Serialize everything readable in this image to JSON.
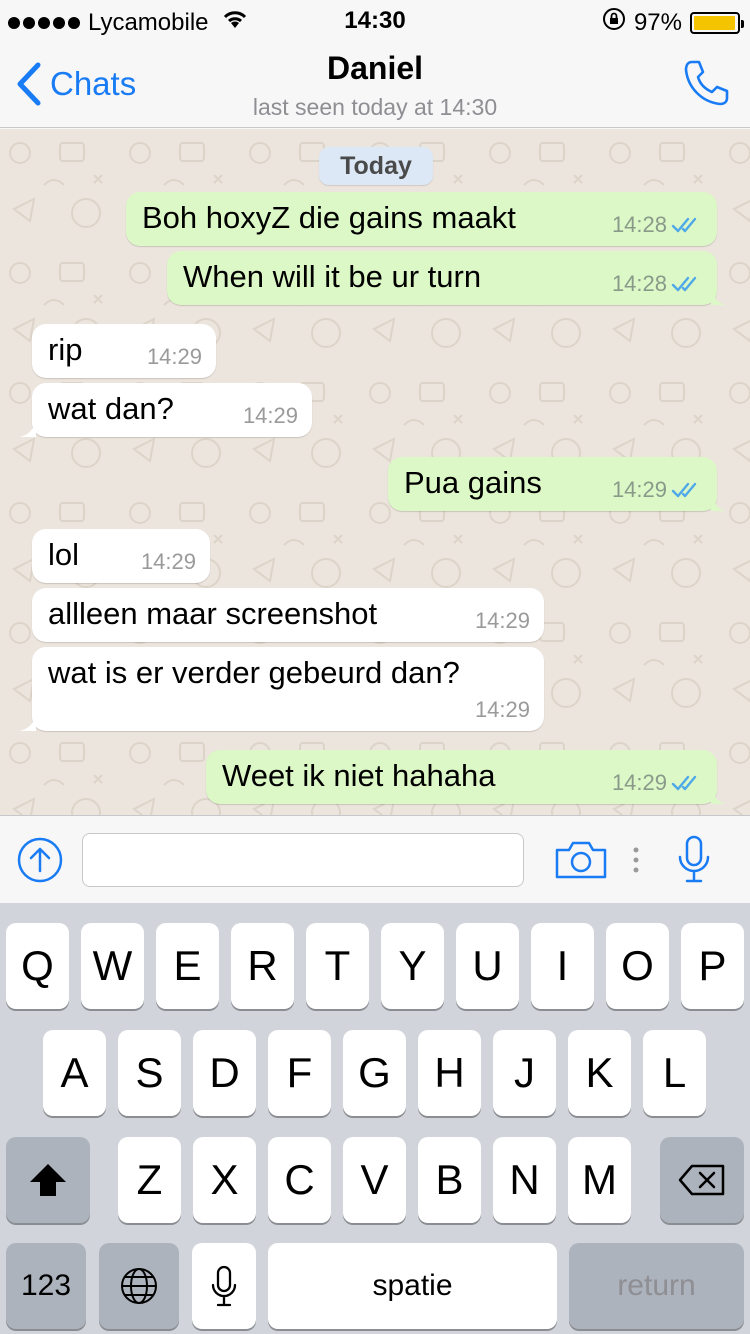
{
  "status_bar": {
    "carrier": "Lycamobile",
    "time": "14:30",
    "battery_percent": "97%",
    "battery_level": 0.97,
    "signal_dots": 5,
    "icons": [
      "wifi-icon",
      "rotation-lock-icon",
      "battery-icon"
    ]
  },
  "nav": {
    "back_label": "Chats",
    "title": "Daniel",
    "subtitle": "last seen today at 14:30",
    "icons": [
      "chevron-left-icon",
      "phone-icon"
    ]
  },
  "chat": {
    "day_label": "Today",
    "messages": [
      {
        "dir": "out",
        "text": "Boh hoxyZ die gains maakt",
        "time": "14:28",
        "status": "read"
      },
      {
        "dir": "out",
        "text": "When will it be ur turn",
        "time": "14:28",
        "status": "read"
      },
      {
        "dir": "in",
        "text": "rip",
        "time": "14:29"
      },
      {
        "dir": "in",
        "text": "wat dan?",
        "time": "14:29"
      },
      {
        "dir": "out",
        "text": "Pua gains",
        "time": "14:29",
        "status": "read"
      },
      {
        "dir": "in",
        "text": "lol",
        "time": "14:29"
      },
      {
        "dir": "in",
        "text": "allleen maar screenshot",
        "time": "14:29"
      },
      {
        "dir": "in",
        "text": "wat is er verder gebeurd dan?",
        "time": "14:29"
      },
      {
        "dir": "out",
        "text": "Weet ik niet hahaha",
        "time": "14:29",
        "status": "read"
      }
    ],
    "colors": {
      "outgoing": "#dcf8c6",
      "incoming": "#ffffff",
      "background": "#ece5dd",
      "read_ticks": "#4fa8e8"
    }
  },
  "input_bar": {
    "value": "",
    "icons": [
      "upload-icon",
      "camera-icon",
      "more-icon",
      "microphone-icon"
    ]
  },
  "keyboard": {
    "row1": [
      "Q",
      "W",
      "E",
      "R",
      "T",
      "Y",
      "U",
      "I",
      "O",
      "P"
    ],
    "row2": [
      "A",
      "S",
      "D",
      "F",
      "G",
      "H",
      "J",
      "K",
      "L"
    ],
    "row3": [
      "Z",
      "X",
      "C",
      "V",
      "B",
      "N",
      "M"
    ],
    "numbers_label": "123",
    "space_label": "spatie",
    "return_label": "return",
    "icons": [
      "shift-icon",
      "backspace-icon",
      "globe-icon",
      "dictation-icon"
    ]
  }
}
